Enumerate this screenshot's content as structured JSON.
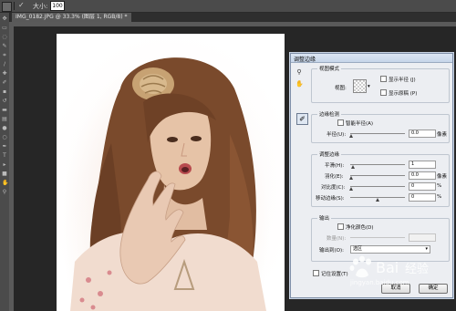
{
  "options_bar": {
    "size_label": "大小:",
    "size_value": "100"
  },
  "document_tab": {
    "label": "IMG_0182.JPG @ 33.3% (图层 1, RGB/8) *"
  },
  "dialog": {
    "title": "调整边缘",
    "view_mode": {
      "legend": "视图模式",
      "view_label": "视图:",
      "show_radius": "显示半径 (J)",
      "show_original": "显示原稿 (P)"
    },
    "edge_detection": {
      "legend": "边缘检测",
      "smart_radius": "智能半径(A)",
      "radius_label": "半径(U):",
      "radius_value": "0.0",
      "radius_unit": "像素"
    },
    "adjust_edge": {
      "legend": "调整边缘",
      "rows": [
        {
          "label": "平滑(H):",
          "value": "1",
          "unit": ""
        },
        {
          "label": "羽化(E):",
          "value": "0.0",
          "unit": "像素"
        },
        {
          "label": "对比度(C):",
          "value": "0",
          "unit": "%"
        },
        {
          "label": "移动边缘(S):",
          "value": "0",
          "unit": "%"
        }
      ]
    },
    "output": {
      "legend": "输出",
      "decontaminate": "净化颜色(D)",
      "amount_label": "数量(N):",
      "output_to_label": "输出到(O):",
      "output_to_value": "选区"
    },
    "remember": "记住设置(T)",
    "cancel": "取消",
    "ok": "确定"
  },
  "watermark": {
    "site": "jingyan.baidu.com"
  }
}
